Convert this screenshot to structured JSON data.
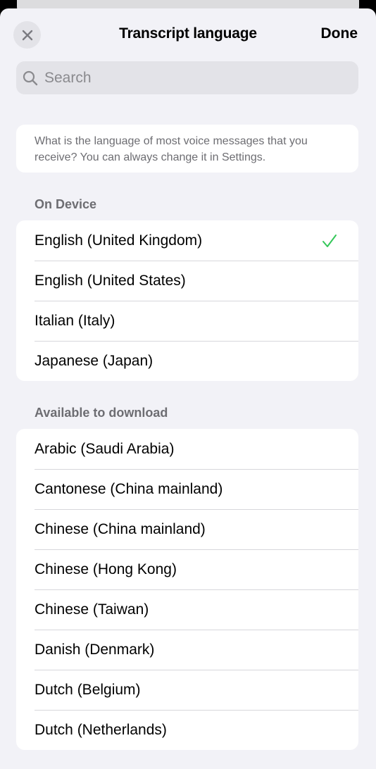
{
  "header": {
    "title": "Transcript language",
    "done_label": "Done",
    "close_icon": "close-icon"
  },
  "search": {
    "placeholder": "Search",
    "value": ""
  },
  "info": {
    "text": "What is the language of most voice messages that you receive? You can always change it in Settings."
  },
  "colors": {
    "background": "#f2f2f7",
    "card": "#ffffff",
    "secondary_text": "#6d6d72",
    "checkmark": "#34c759"
  },
  "on_device": {
    "header": "On Device",
    "items": [
      {
        "label": "English (United Kingdom)",
        "selected": true
      },
      {
        "label": "English (United States)",
        "selected": false
      },
      {
        "label": "Italian (Italy)",
        "selected": false
      },
      {
        "label": "Japanese (Japan)",
        "selected": false
      }
    ]
  },
  "available": {
    "header": "Available to download",
    "items": [
      {
        "label": "Arabic (Saudi Arabia)"
      },
      {
        "label": "Cantonese (China mainland)"
      },
      {
        "label": "Chinese (China mainland)"
      },
      {
        "label": "Chinese (Hong Kong)"
      },
      {
        "label": "Chinese (Taiwan)"
      },
      {
        "label": "Danish (Denmark)"
      },
      {
        "label": "Dutch (Belgium)"
      },
      {
        "label": "Dutch (Netherlands)"
      }
    ]
  }
}
